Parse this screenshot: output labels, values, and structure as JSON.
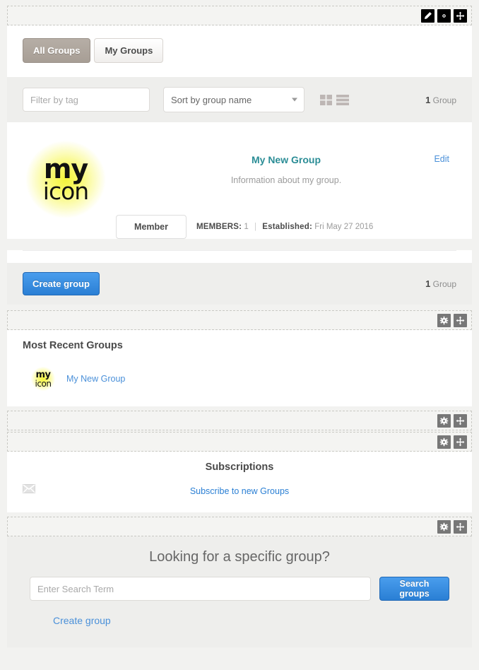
{
  "widget_controls": {
    "edit_icon": "pencil-icon",
    "settings_icon": "gear-icon",
    "move_icon": "move-icon"
  },
  "tabs": [
    {
      "label": "All Groups",
      "active": true
    },
    {
      "label": "My Groups",
      "active": false
    }
  ],
  "filter_bar": {
    "filter_placeholder": "Filter by tag",
    "filter_value": "",
    "sort_selected": "Sort by group name",
    "sort_options": [
      "Sort by group name"
    ],
    "grid_view_icon": "grid-view-icon",
    "list_view_icon": "list-view-icon",
    "count_number": "1",
    "count_label": "Group"
  },
  "group_card": {
    "avatar_line1": "my",
    "avatar_line2": "icon",
    "title": "My New Group",
    "description": "Information about my group.",
    "edit_label": "Edit",
    "member_button": "Member",
    "members_label": "MEMBERS:",
    "members_value": "1",
    "separator": "|",
    "established_label": "Established:",
    "established_value": "Fri May 27 2016"
  },
  "create_bar": {
    "button_label": "Create group",
    "count_number": "1",
    "count_label": "Group"
  },
  "recent": {
    "title": "Most Recent Groups",
    "items": [
      {
        "avatar_line1": "my",
        "avatar_line2": "icon",
        "label": "My New Group"
      }
    ]
  },
  "subscriptions": {
    "title": "Subscriptions",
    "envelope_icon": "envelope-icon",
    "link_label": "Subscribe to new Groups"
  },
  "search": {
    "heading": "Looking for a specific group?",
    "input_placeholder": "Enter Search Term",
    "input_value": "",
    "button_label": "Search groups",
    "create_link_label": "Create group"
  },
  "colors": {
    "accent_blue": "#2a7fd4",
    "link_blue": "#4a90d9",
    "title_teal": "#2b8d96",
    "tab_active": "#a79e95",
    "avatar_yellow": "#f4f43c",
    "page_bg": "#f2f2f0"
  }
}
